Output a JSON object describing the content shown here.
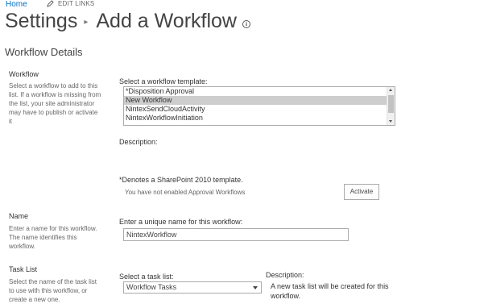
{
  "top_nav": {
    "home": "Home",
    "edit_links": "EDIT LINKS"
  },
  "page": {
    "title_prefix": "Settings",
    "separator": "▸",
    "title": "Add a Workflow",
    "info_icon": "ⓘ"
  },
  "section_title": "Workflow Details",
  "workflow": {
    "heading": "Workflow",
    "description": "Select a workflow to add to this list. If a workflow is missing from the list, your site administrator may have to publish or activate it",
    "template_label": "Select a workflow template:",
    "templates": [
      {
        "label": "*Disposition Approval",
        "selected": false
      },
      {
        "label": "New Workflow",
        "selected": true
      },
      {
        "label": "NintexSendCloudActivity",
        "selected": false
      },
      {
        "label": "NintexWorkflowInitiation",
        "selected": false
      }
    ],
    "description_label": "Description:",
    "sp2010_note": "*Denotes a SharePoint 2010 template.",
    "approval_note": "You have not enabled Approval Workflows",
    "activate_button": "Activate"
  },
  "name": {
    "heading": "Name",
    "description": "Enter a name for this workflow. The name identifies this workflow.",
    "field_label": "Enter a unique name for this workflow:",
    "value": "NintexWorkflow"
  },
  "task_list": {
    "heading": "Task List",
    "description": "Select the name of the task list to use with this workflow, or create a new one.",
    "field_label": "Select a task list:",
    "selected": "Workflow Tasks",
    "desc_label": "Description:",
    "desc_text": "A new task list will be created for this workflow."
  }
}
